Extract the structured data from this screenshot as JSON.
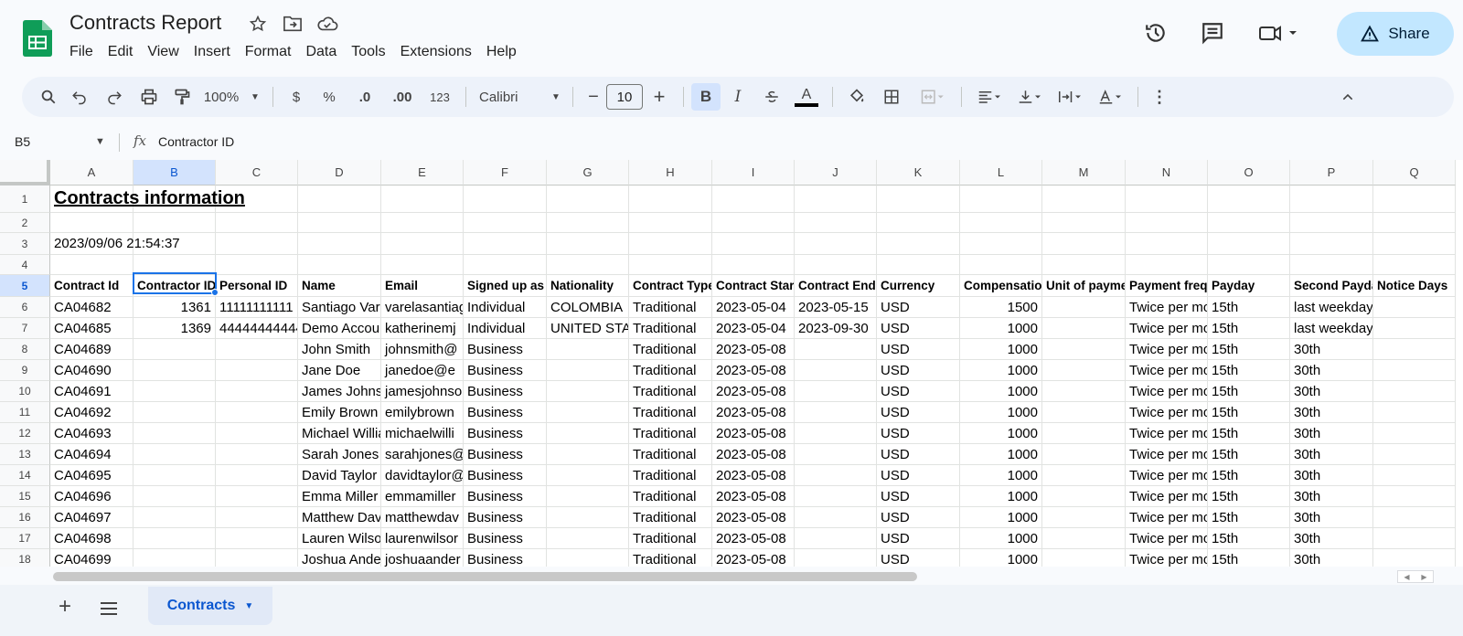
{
  "app": {
    "title": "Contracts Report",
    "share_label": "Share",
    "menu": [
      "File",
      "Edit",
      "View",
      "Insert",
      "Format",
      "Data",
      "Tools",
      "Extensions",
      "Help"
    ]
  },
  "toolbar": {
    "zoom": "100%",
    "currency": "$",
    "percent": "%",
    "decrease_decimal": ".0",
    "increase_decimal": ".00",
    "number_format": "123",
    "font": "Calibri",
    "font_size": "10",
    "bold": "B",
    "italic": "I",
    "text_color": "A"
  },
  "formula_bar": {
    "cell_ref": "B5",
    "value": "Contractor ID"
  },
  "columns": [
    "A",
    "B",
    "C",
    "D",
    "E",
    "F",
    "G",
    "H",
    "I",
    "J",
    "K",
    "L",
    "M",
    "N",
    "O",
    "P",
    "Q"
  ],
  "selected_column": "B",
  "selected_row": "5",
  "rows": [
    {
      "n": "1",
      "cells": [
        "Contracts information",
        "",
        "",
        "",
        "",
        "",
        "",
        "",
        "",
        "",
        "",
        "",
        "",
        "",
        "",
        "",
        ""
      ]
    },
    {
      "n": "2",
      "cells": [
        "",
        "",
        "",
        "",
        "",
        "",
        "",
        "",
        "",
        "",
        "",
        "",
        "",
        "",
        "",
        "",
        ""
      ]
    },
    {
      "n": "3",
      "cells": [
        "2023/09/06 21:54:37",
        "",
        "",
        "",
        "",
        "",
        "",
        "",
        "",
        "",
        "",
        "",
        "",
        "",
        "",
        "",
        ""
      ]
    },
    {
      "n": "4",
      "cells": [
        "",
        "",
        "",
        "",
        "",
        "",
        "",
        "",
        "",
        "",
        "",
        "",
        "",
        "",
        "",
        "",
        ""
      ]
    },
    {
      "n": "5",
      "cells": [
        "Contract Id",
        "Contractor ID",
        "Personal ID",
        "Name",
        "Email",
        "Signed up as",
        "Nationality",
        "Contract Type",
        "Contract Start",
        "Contract End",
        "Currency",
        "Compensation",
        "Unit of payment",
        "Payment frequency",
        "Payday",
        "Second Payday",
        "Notice Days"
      ]
    },
    {
      "n": "6",
      "cells": [
        "CA04682",
        "1361",
        "11111111111",
        "Santiago Varela",
        "varelasantiago",
        "Individual",
        "COLOMBIA",
        "Traditional",
        "2023-05-04",
        "2023-05-15",
        "USD",
        "1500",
        "",
        "Twice per month",
        "15th",
        "last weekday",
        ""
      ]
    },
    {
      "n": "7",
      "cells": [
        "CA04685",
        "1369",
        "44444444444",
        "Demo Account",
        "katherinemj",
        "Individual",
        "UNITED STATES",
        "Traditional",
        "2023-05-04",
        "2023-09-30",
        "USD",
        "1000",
        "",
        "Twice per month",
        "15th",
        "last weekday",
        ""
      ]
    },
    {
      "n": "8",
      "cells": [
        "CA04689",
        "",
        "",
        "John Smith",
        "johnsmith@",
        "Business",
        "",
        "Traditional",
        "2023-05-08",
        "",
        "USD",
        "1000",
        "",
        "Twice per month",
        "15th",
        "30th",
        ""
      ]
    },
    {
      "n": "9",
      "cells": [
        "CA04690",
        "",
        "",
        "Jane Doe",
        "janedoe@e",
        "Business",
        "",
        "Traditional",
        "2023-05-08",
        "",
        "USD",
        "1000",
        "",
        "Twice per month",
        "15th",
        "30th",
        ""
      ]
    },
    {
      "n": "10",
      "cells": [
        "CA04691",
        "",
        "",
        "James Johnson",
        "jamesjohnson",
        "Business",
        "",
        "Traditional",
        "2023-05-08",
        "",
        "USD",
        "1000",
        "",
        "Twice per month",
        "15th",
        "30th",
        ""
      ]
    },
    {
      "n": "11",
      "cells": [
        "CA04692",
        "",
        "",
        "Emily Brown",
        "emilybrown",
        "Business",
        "",
        "Traditional",
        "2023-05-08",
        "",
        "USD",
        "1000",
        "",
        "Twice per month",
        "15th",
        "30th",
        ""
      ]
    },
    {
      "n": "12",
      "cells": [
        "CA04693",
        "",
        "",
        "Michael Williams",
        "michaelwilli",
        "Business",
        "",
        "Traditional",
        "2023-05-08",
        "",
        "USD",
        "1000",
        "",
        "Twice per month",
        "15th",
        "30th",
        ""
      ]
    },
    {
      "n": "13",
      "cells": [
        "CA04694",
        "",
        "",
        "Sarah Jones",
        "sarahjones@",
        "Business",
        "",
        "Traditional",
        "2023-05-08",
        "",
        "USD",
        "1000",
        "",
        "Twice per month",
        "15th",
        "30th",
        ""
      ]
    },
    {
      "n": "14",
      "cells": [
        "CA04695",
        "",
        "",
        "David Taylor",
        "davidtaylor@",
        "Business",
        "",
        "Traditional",
        "2023-05-08",
        "",
        "USD",
        "1000",
        "",
        "Twice per month",
        "15th",
        "30th",
        ""
      ]
    },
    {
      "n": "15",
      "cells": [
        "CA04696",
        "",
        "",
        "Emma Miller",
        "emmamiller",
        "Business",
        "",
        "Traditional",
        "2023-05-08",
        "",
        "USD",
        "1000",
        "",
        "Twice per month",
        "15th",
        "30th",
        ""
      ]
    },
    {
      "n": "16",
      "cells": [
        "CA04697",
        "",
        "",
        "Matthew Davis",
        "matthewdav",
        "Business",
        "",
        "Traditional",
        "2023-05-08",
        "",
        "USD",
        "1000",
        "",
        "Twice per month",
        "15th",
        "30th",
        ""
      ]
    },
    {
      "n": "17",
      "cells": [
        "CA04698",
        "",
        "",
        "Lauren Wilson",
        "laurenwilsor",
        "Business",
        "",
        "Traditional",
        "2023-05-08",
        "",
        "USD",
        "1000",
        "",
        "Twice per month",
        "15th",
        "30th",
        ""
      ]
    },
    {
      "n": "18",
      "cells": [
        "CA04699",
        "",
        "",
        "Joshua Anderson",
        "joshuaander",
        "Business",
        "",
        "Traditional",
        "2023-05-08",
        "",
        "USD",
        "1000",
        "",
        "Twice per month",
        "15th",
        "30th",
        ""
      ]
    }
  ],
  "sheet": {
    "tab_name": "Contracts"
  },
  "colors": {
    "accent": "#0b57d0",
    "share_bg": "#c2e7ff",
    "selection": "#1a73e8",
    "sheets_green": "#0f9d58"
  }
}
